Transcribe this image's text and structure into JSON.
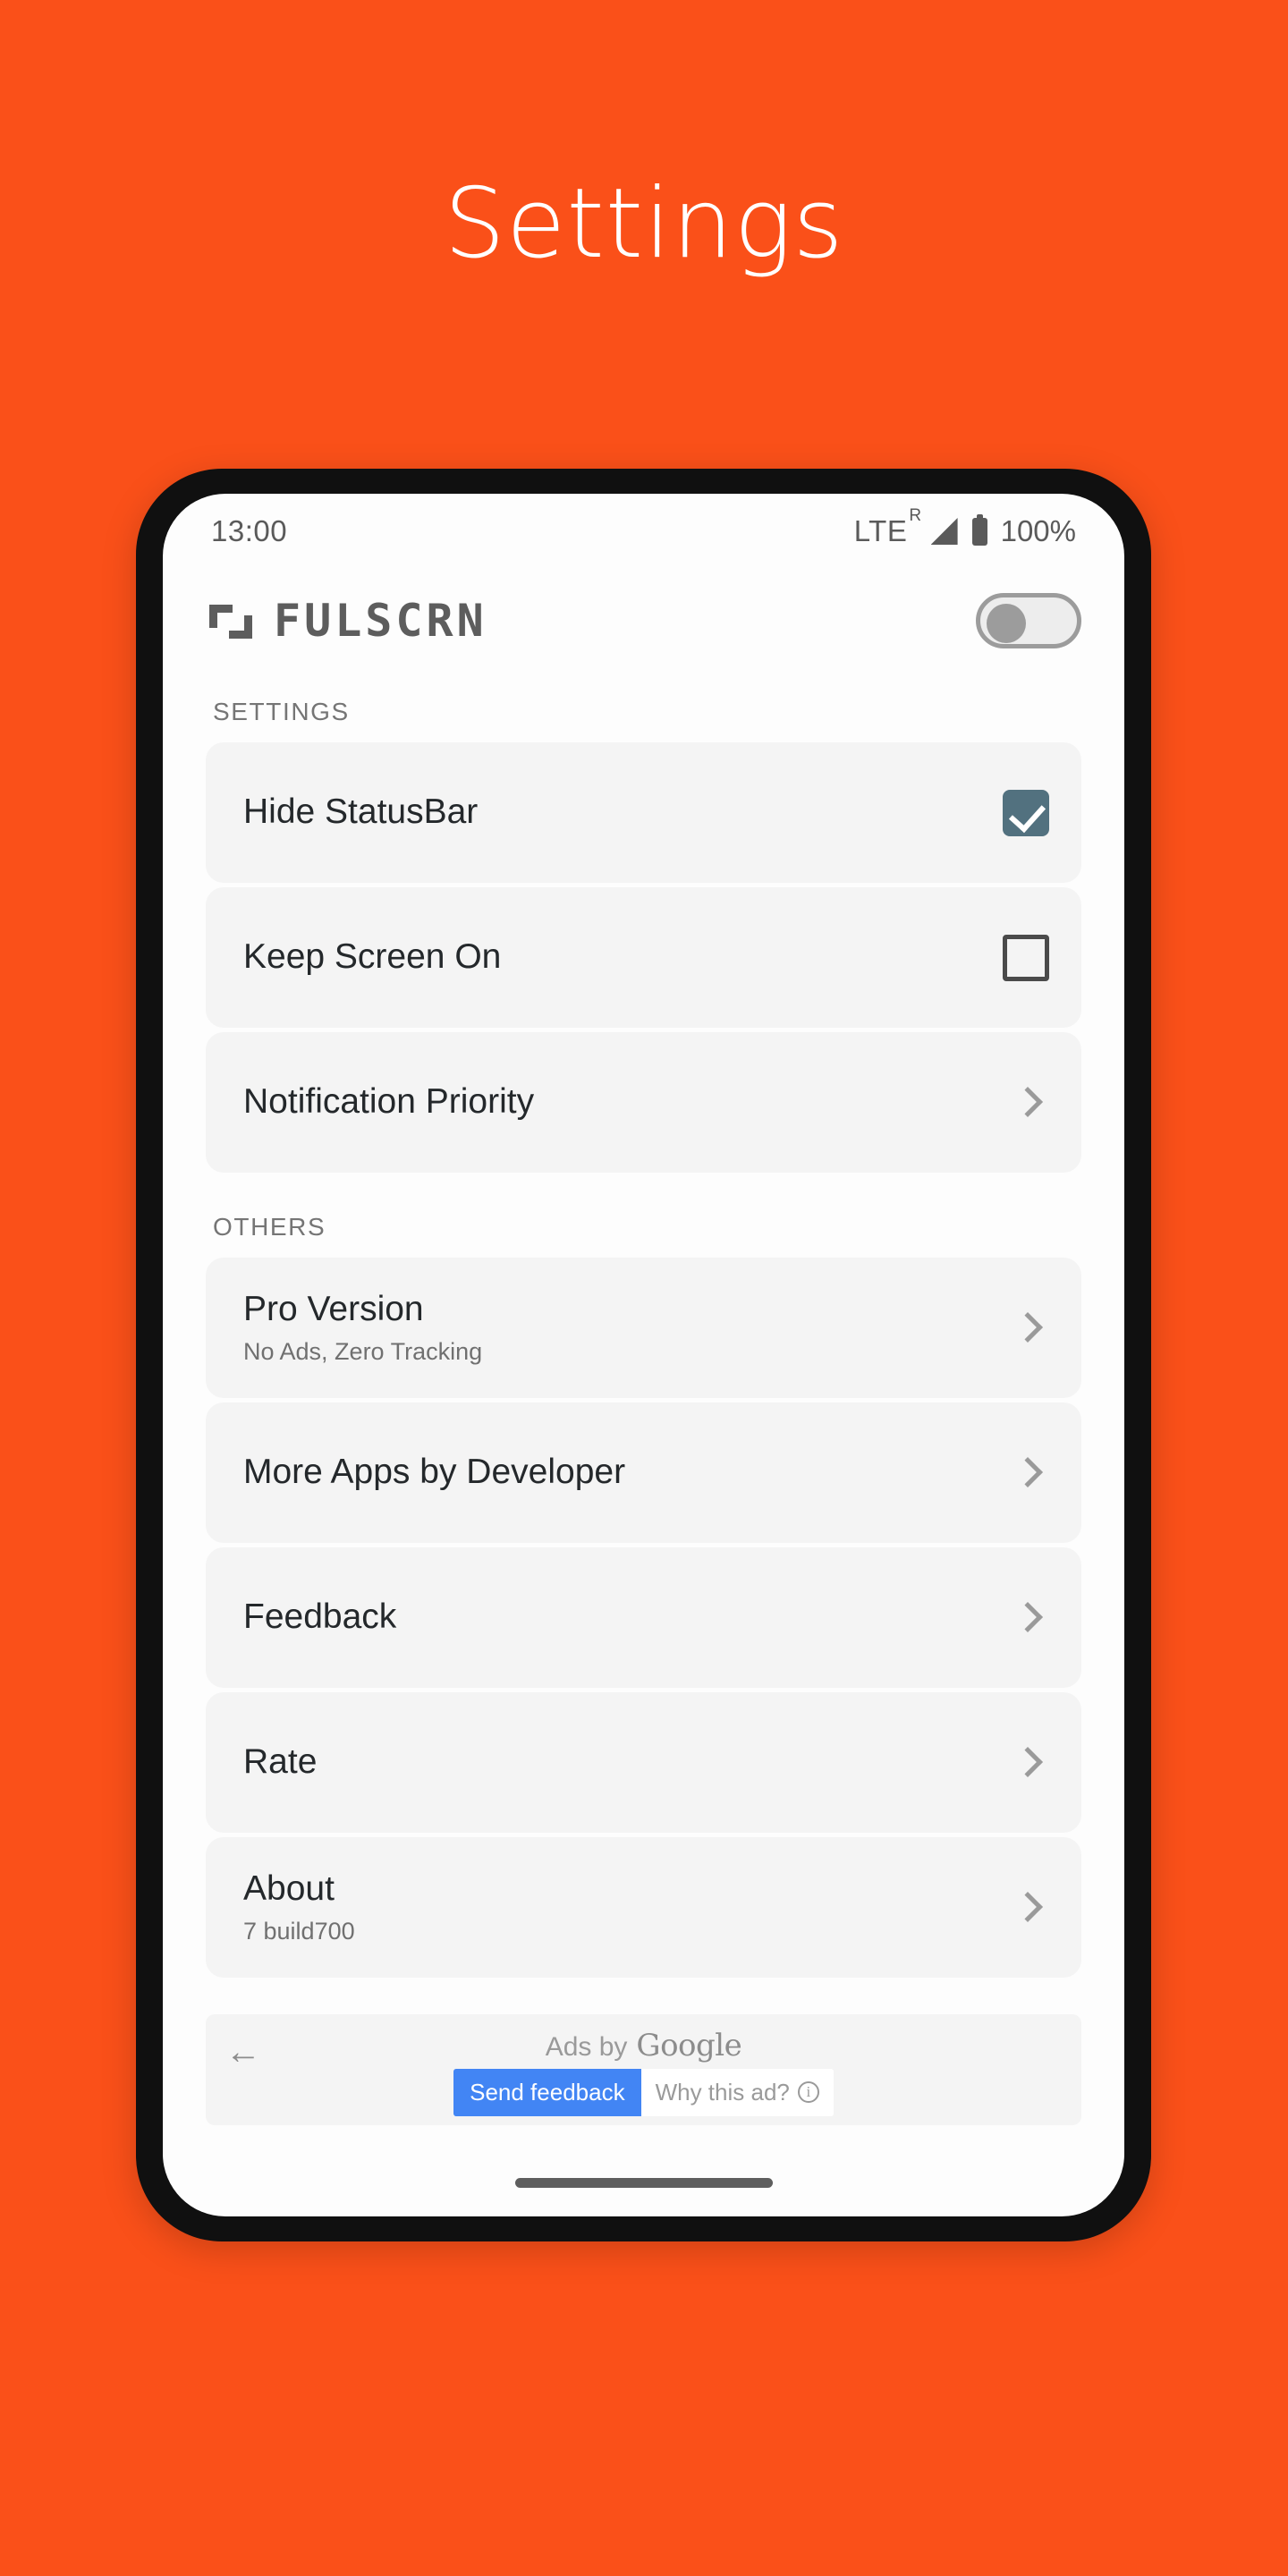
{
  "promo": {
    "title": "Settings",
    "background_color": "#FA5019"
  },
  "status_bar": {
    "time": "13:00",
    "network_type": "LTE",
    "roaming_indicator": "R",
    "battery_percent": "100%"
  },
  "app_header": {
    "brand_name": "FULSCRN",
    "master_toggle": {
      "state": "off",
      "accent_color": "#9C9C9C"
    }
  },
  "sections": [
    {
      "label": "SETTINGS",
      "rows": [
        {
          "title": "Hide StatusBar",
          "subtitle": "",
          "control": "checkbox",
          "checked": true
        },
        {
          "title": "Keep Screen On",
          "subtitle": "",
          "control": "checkbox",
          "checked": false
        },
        {
          "title": "Notification Priority",
          "subtitle": "",
          "control": "chevron",
          "checked": false
        }
      ]
    },
    {
      "label": "OTHERS",
      "rows": [
        {
          "title": "Pro Version",
          "subtitle": "No Ads, Zero Tracking",
          "control": "chevron",
          "checked": false
        },
        {
          "title": "More Apps by Developer",
          "subtitle": "",
          "control": "chevron",
          "checked": false
        },
        {
          "title": "Feedback",
          "subtitle": "",
          "control": "chevron",
          "checked": false
        },
        {
          "title": "Rate",
          "subtitle": "",
          "control": "chevron",
          "checked": false
        },
        {
          "title": "About",
          "subtitle": "7 build700",
          "control": "chevron",
          "checked": false
        }
      ]
    }
  ],
  "ad": {
    "back_glyph": "←",
    "ads_by_prefix": "Ads by",
    "ads_by_brand": "Google",
    "send_feedback_label": "Send feedback",
    "why_this_ad_label": "Why this ad?",
    "info_glyph": "i",
    "feedback_color": "#4285F4"
  },
  "checkbox_colors": {
    "checked_fill": "#52717F",
    "unchecked_border": "#4A4A4A"
  }
}
